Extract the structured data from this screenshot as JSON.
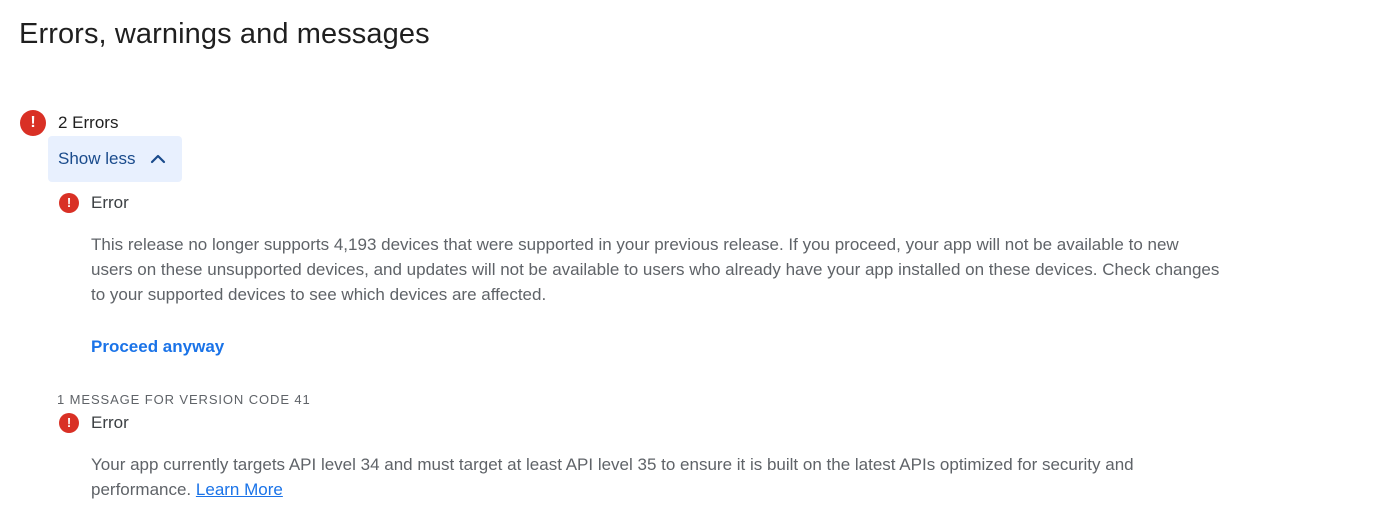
{
  "page": {
    "title": "Errors, warnings and messages"
  },
  "summary": {
    "count_label": "2 Errors",
    "toggle_label": "Show less",
    "toggle_icon": "chevron-up-icon"
  },
  "errors": [
    {
      "icon": "error-icon",
      "title": "Error",
      "body": "This release no longer supports 4,193 devices that were supported in your previous release. If you proceed, your app will not be available to new users on these unsupported devices, and updates will not be available to users who already have your app installed on these devices. Check changes to your supported devices to see which devices are affected.",
      "action_label": "Proceed anyway"
    }
  ],
  "version_messages": {
    "section_label": "1 MESSAGE FOR VERSION CODE 41",
    "items": [
      {
        "icon": "error-icon",
        "title": "Error",
        "body": "Your app currently targets API level 34 and must target at least API level 35 to ensure it is built on the latest APIs optimized for security and performance.",
        "link_label": "Learn More"
      }
    ]
  },
  "colors": {
    "error_red": "#d93025",
    "link_blue": "#1a73e8",
    "button_bg": "#e8f0fe",
    "button_text": "#1a4b8c"
  }
}
